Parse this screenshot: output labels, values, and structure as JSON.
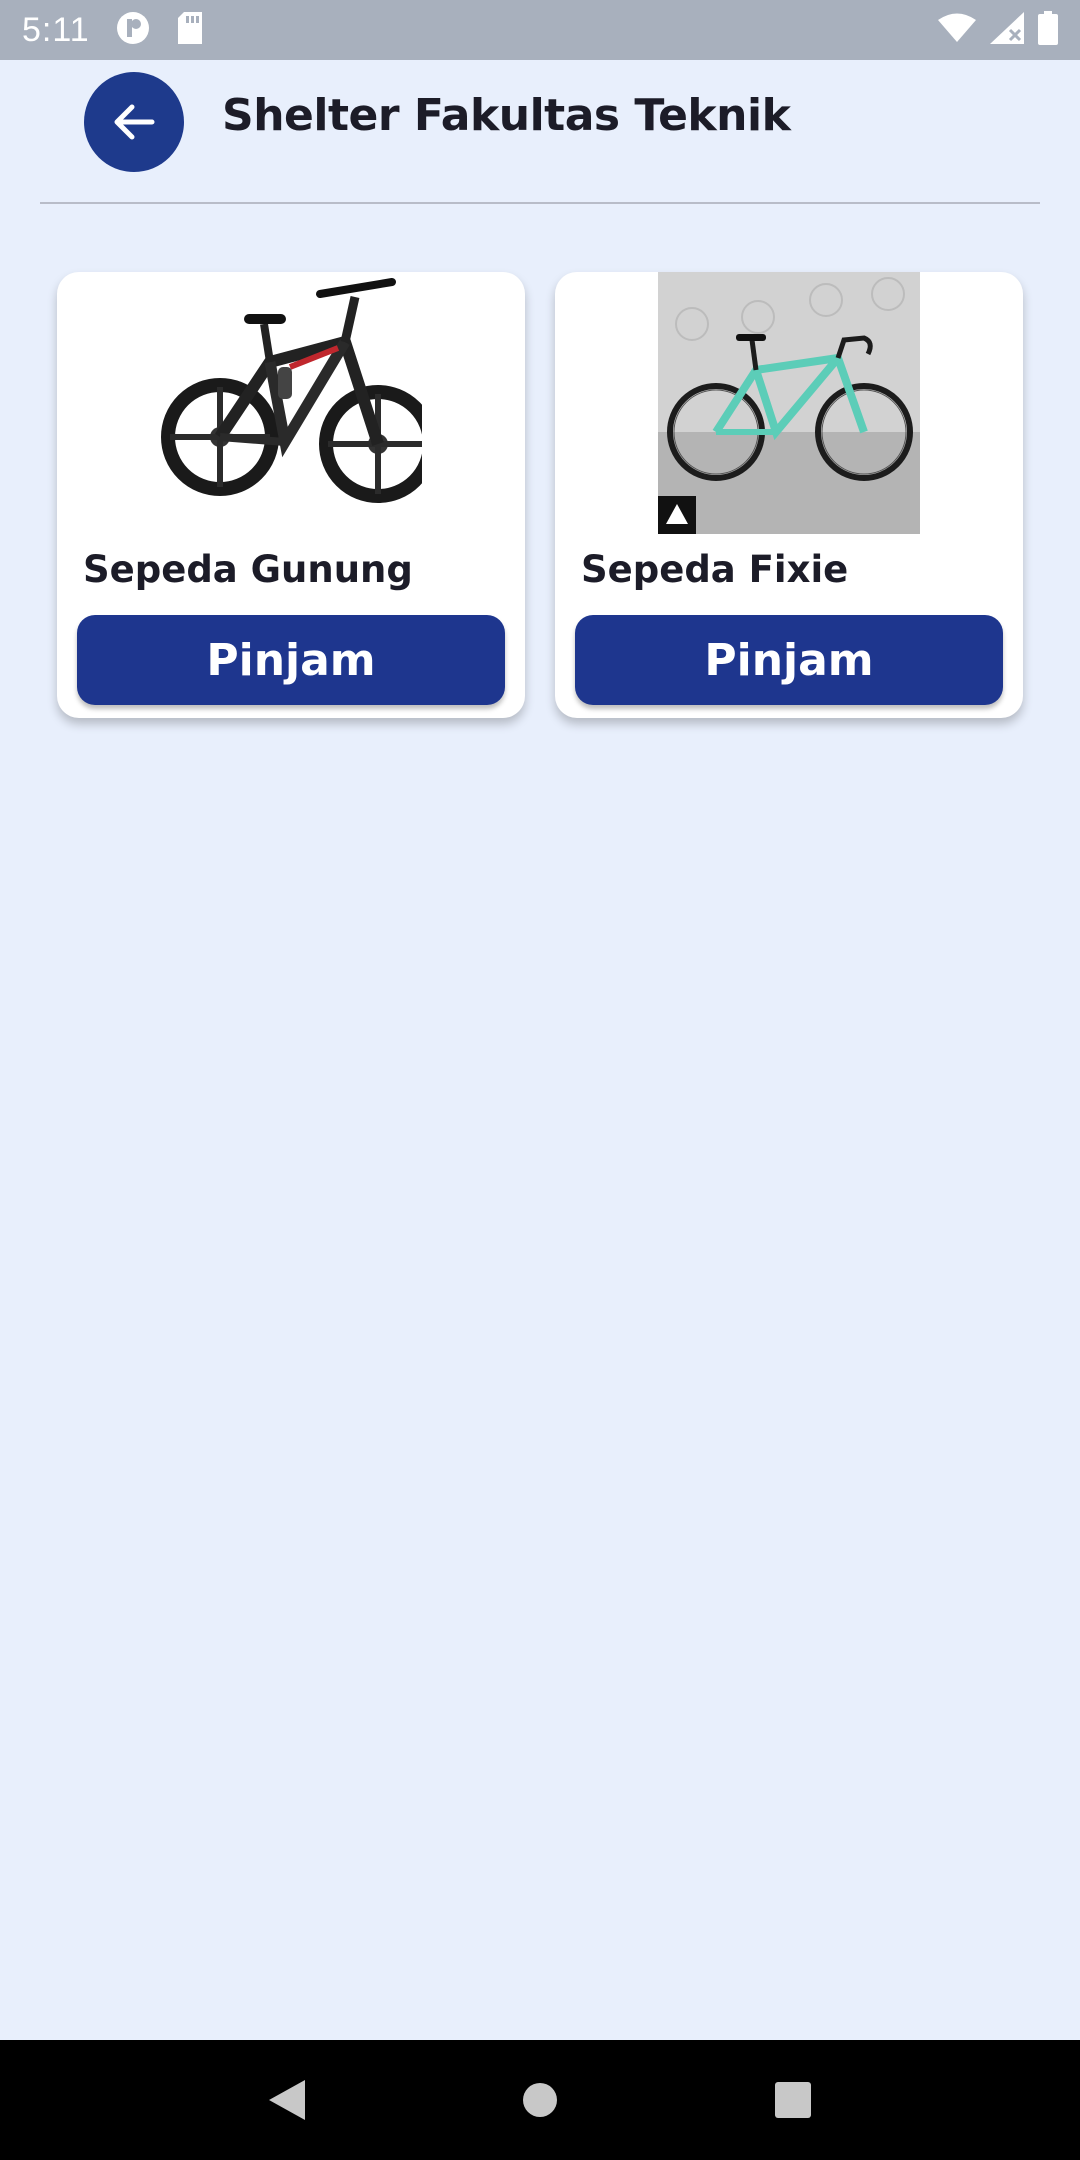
{
  "status_bar": {
    "time": "5:11",
    "icons": [
      "app-notification-icon",
      "sd-card-icon",
      "wifi-icon",
      "signal-icon",
      "battery-icon"
    ]
  },
  "header": {
    "title": "Shelter Fakultas Teknik",
    "back_icon": "arrow-left-icon"
  },
  "bikes": [
    {
      "name": "Sepeda Gunung",
      "button_label": "Pinjam",
      "image": "mountain-bike-photo"
    },
    {
      "name": "Sepeda Fixie",
      "button_label": "Pinjam",
      "image": "fixie-bike-photo"
    }
  ],
  "nav_bar": {
    "icons": [
      "back-triangle-icon",
      "home-circle-icon",
      "recents-square-icon"
    ]
  },
  "colors": {
    "background": "#e8effc",
    "primary": "#1e368e",
    "status_bar": "#a8b0bd"
  }
}
